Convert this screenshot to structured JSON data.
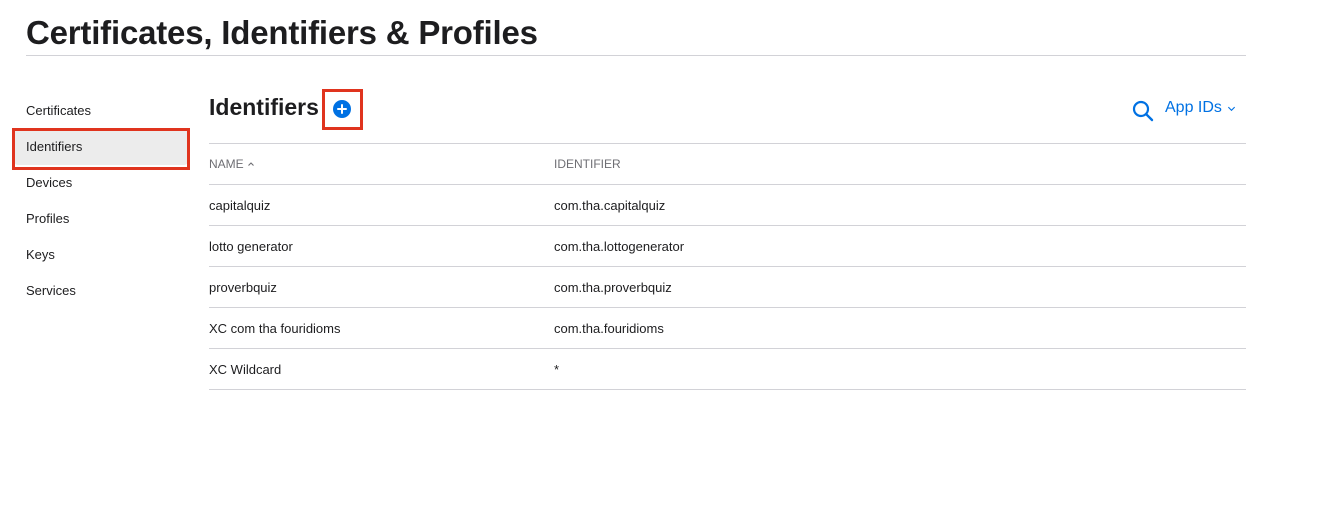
{
  "page": {
    "title": "Certificates, Identifiers & Profiles"
  },
  "sidebar": {
    "items": [
      {
        "label": "Certificates",
        "active": false
      },
      {
        "label": "Identifiers",
        "active": true
      },
      {
        "label": "Devices",
        "active": false
      },
      {
        "label": "Profiles",
        "active": false
      },
      {
        "label": "Keys",
        "active": false
      },
      {
        "label": "Services",
        "active": false
      }
    ]
  },
  "main": {
    "section_title": "Identifiers",
    "add_icon": "plus-circle-icon",
    "search_icon": "search-icon",
    "filter_label": "App IDs",
    "filter_icon": "chevron-down-icon"
  },
  "table": {
    "columns": [
      "NAME",
      "IDENTIFIER"
    ],
    "sort_column": "NAME",
    "sort_direction": "ascending",
    "rows": [
      {
        "name": "capitalquiz",
        "identifier": "com.tha.capitalquiz"
      },
      {
        "name": "lotto generator",
        "identifier": "com.tha.lottogenerator"
      },
      {
        "name": "proverbquiz",
        "identifier": "com.tha.proverbquiz"
      },
      {
        "name": "XC com tha fouridioms",
        "identifier": "com.tha.fouridioms"
      },
      {
        "name": "XC Wildcard",
        "identifier": "*"
      }
    ]
  },
  "colors": {
    "accent": "#0071e3",
    "highlight": "#e0341e",
    "active_bg": "#ececec",
    "divider": "#d2d2d7"
  }
}
